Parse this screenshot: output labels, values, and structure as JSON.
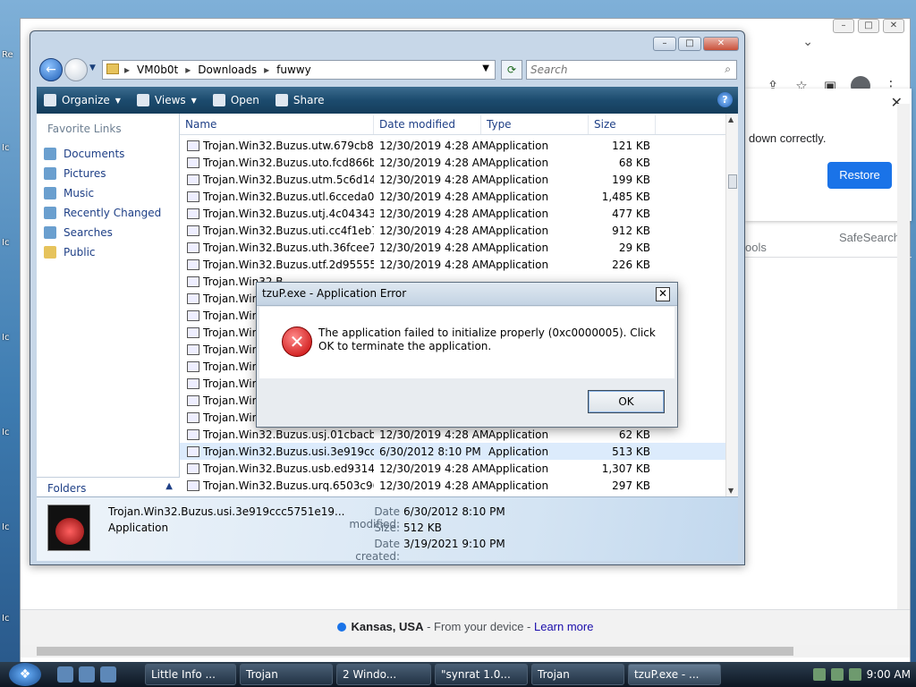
{
  "desktop": {
    "icon_labels": [
      "Re",
      "Ic",
      "Ic",
      "Ic",
      "Ic",
      "Ic",
      "Ic"
    ]
  },
  "chrome": {
    "notice_text": "down correctly.",
    "restore_label": "Restore",
    "safesearch_label": "SafeSearch",
    "tools_label": "ools",
    "footer": {
      "location": "Kansas, USA",
      "from_device": " - From your device - ",
      "learn_more": "Learn more"
    }
  },
  "explorer": {
    "path": [
      "VM0b0t",
      "Downloads",
      "fuwwy"
    ],
    "search_placeholder": "Search",
    "toolbar": {
      "organize": "Organize",
      "views": "Views",
      "open": "Open",
      "share": "Share"
    },
    "favorite_links_title": "Favorite Links",
    "favorite_links": [
      "Documents",
      "Pictures",
      "Music",
      "Recently Changed",
      "Searches",
      "Public"
    ],
    "folders_label": "Folders",
    "columns": [
      "Name",
      "Date modified",
      "Type",
      "Size"
    ],
    "rows": [
      {
        "name": "Trojan.Win32.Buzus.utw.679cb8e...",
        "date": "12/30/2019 4:28 AM",
        "type": "Application",
        "size": "121 KB"
      },
      {
        "name": "Trojan.Win32.Buzus.uto.fcd866ba...",
        "date": "12/30/2019 4:28 AM",
        "type": "Application",
        "size": "68 KB"
      },
      {
        "name": "Trojan.Win32.Buzus.utm.5c6d142...",
        "date": "12/30/2019 4:28 AM",
        "type": "Application",
        "size": "199 KB"
      },
      {
        "name": "Trojan.Win32.Buzus.utl.6cceda02...",
        "date": "12/30/2019 4:28 AM",
        "type": "Application",
        "size": "1,485 KB"
      },
      {
        "name": "Trojan.Win32.Buzus.utj.4c043431e...",
        "date": "12/30/2019 4:28 AM",
        "type": "Application",
        "size": "477 KB"
      },
      {
        "name": "Trojan.Win32.Buzus.uti.cc4f1eb79...",
        "date": "12/30/2019 4:28 AM",
        "type": "Application",
        "size": "912 KB"
      },
      {
        "name": "Trojan.Win32.Buzus.uth.36fcee7d...",
        "date": "12/30/2019 4:28 AM",
        "type": "Application",
        "size": "29 KB"
      },
      {
        "name": "Trojan.Win32.Buzus.utf.2d955555...",
        "date": "12/30/2019 4:28 AM",
        "type": "Application",
        "size": "226 KB"
      },
      {
        "name": "Trojan.Win32.B",
        "date": "",
        "type": "",
        "size": ""
      },
      {
        "name": "Trojan.Wir",
        "date": "",
        "type": "",
        "size": ""
      },
      {
        "name": "Trojan.Wir",
        "date": "",
        "type": "",
        "size": ""
      },
      {
        "name": "Trojan.Wir",
        "date": "",
        "type": "",
        "size": ""
      },
      {
        "name": "Trojan.Wir",
        "date": "",
        "type": "",
        "size": ""
      },
      {
        "name": "Trojan.Wir",
        "date": "",
        "type": "",
        "size": ""
      },
      {
        "name": "Trojan.Wir",
        "date": "",
        "type": "",
        "size": ""
      },
      {
        "name": "Trojan.Wir",
        "date": "",
        "type": "",
        "size": ""
      },
      {
        "name": "Trojan.Wir",
        "date": "",
        "type": "",
        "size": ""
      },
      {
        "name": "Trojan.Win32.Buzus.usj.01cbacbc...",
        "date": "12/30/2019 4:28 AM",
        "type": "Application",
        "size": "62 KB"
      },
      {
        "name": "Trojan.Win32.Buzus.usi.3e919ccc...",
        "date": "6/30/2012 8:10 PM",
        "type": "Application",
        "size": "513 KB"
      },
      {
        "name": "Trojan.Win32.Buzus.usb.ed931468...",
        "date": "12/30/2019 4:28 AM",
        "type": "Application",
        "size": "1,307 KB"
      },
      {
        "name": "Trojan.Win32.Buzus.urq.6503c96b...",
        "date": "12/30/2019 4:28 AM",
        "type": "Application",
        "size": "297 KB"
      }
    ],
    "details": {
      "name": "Trojan.Win32.Buzus.usi.3e919ccc5751e19...",
      "type": "Application",
      "date_modified_label": "Date modified:",
      "date_modified": "6/30/2012 8:10 PM",
      "size_label": "Size:",
      "size": "512 KB",
      "date_created_label": "Date created:",
      "date_created": "3/19/2021 9:10 PM"
    }
  },
  "dialog": {
    "title": "tzuP.exe - Application Error",
    "message": "The application failed to initialize properly (0xc0000005). Click OK to terminate the application.",
    "ok_label": "OK"
  },
  "taskbar": {
    "buttons": [
      "Little Info ...",
      "Trojan",
      "2 Windo...",
      "\"synrat 1.0...",
      "Trojan",
      "tzuP.exe - ..."
    ],
    "clock": "9:00 AM"
  }
}
